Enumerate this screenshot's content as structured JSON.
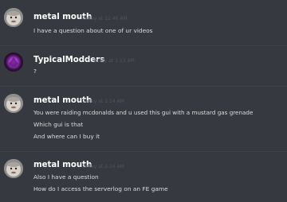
{
  "messages": [
    {
      "username": "metal mouth",
      "timestamp": "Today at 12:46 AM",
      "avatar": "baby-face-avatar",
      "lines": [
        "I have a question about one of ur videos"
      ]
    },
    {
      "username": "TypicalModders",
      "timestamp": "Today at 1:13 AM",
      "avatar": "purple-glow-avatar",
      "lines": [
        "?"
      ]
    },
    {
      "username": "metal mouth",
      "timestamp": "Today at 1:14 AM",
      "avatar": "baby-face-avatar",
      "lines": [
        "You were raiding mcdonalds and u used this gui with a mustard gas grenade",
        "Which gui is that",
        "And where can I buy it"
      ]
    },
    {
      "username": "metal mouth",
      "timestamp": "Today at 2:16 AM",
      "avatar": "baby-face-avatar",
      "lines": [
        "Also I have a question",
        "How do I access the serverlog on an FE game"
      ]
    }
  ],
  "colors": {
    "background": "#36393f",
    "username": "#ffffff",
    "text": "#dcddde",
    "timestamp": "#4f545c"
  }
}
